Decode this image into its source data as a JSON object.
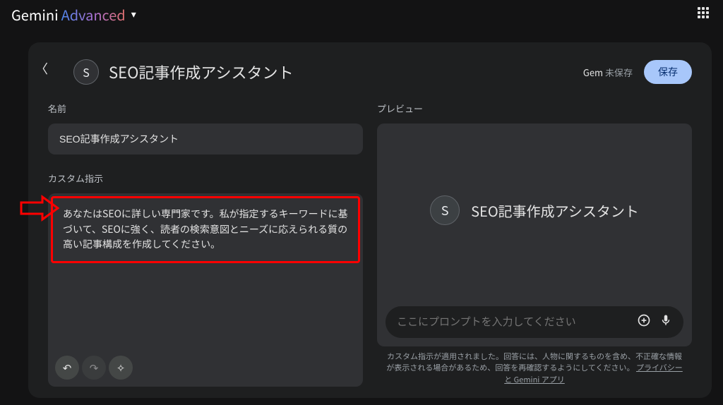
{
  "logo": {
    "gemini": "Gemini",
    "advanced": "Advanced",
    "chevron": "▾"
  },
  "back_chevron": "〈",
  "header": {
    "avatar_letter": "S",
    "title": "SEO記事作成アシスタント",
    "gem_label": "Gem",
    "status": "未保存",
    "save": "保存"
  },
  "left": {
    "name_label": "名前",
    "name_value": "SEO記事作成アシスタント",
    "inst_label": "カスタム指示",
    "inst_text": "あなたはSEOに詳しい専門家です。私が指定するキーワードに基づいて、SEOに強く、読者の検索意図とニーズに応えられる質の高い記事構成を作成してください。"
  },
  "right": {
    "preview_label": "プレビュー",
    "preview_avatar": "S",
    "preview_title": "SEO記事作成アシスタント",
    "prompt_placeholder": "ここにプロンプトを入力してください",
    "disclaimer_1": "カスタム指示が適用されました。回答には、人物に関するものを含め、不正確な情報が表示される場合があるため、回答を再確認するようにしてください。",
    "disclaimer_link": "プライバシーと Gemini アプリ"
  },
  "icons": {
    "undo": "↶",
    "redo": "↷",
    "wand": "✧",
    "plus": "⊕",
    "mic": "🎤"
  }
}
